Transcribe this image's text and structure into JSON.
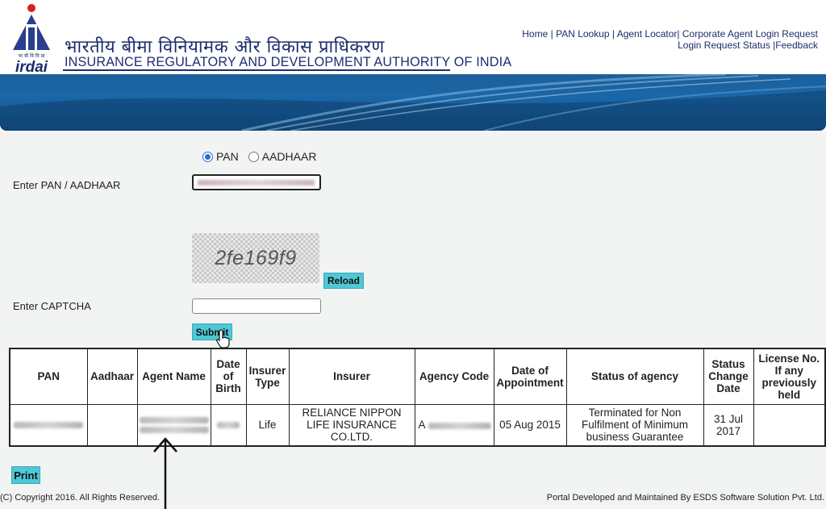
{
  "header": {
    "logo_text": "irdai",
    "logo_hindi": "भा बी वि वि प्रा",
    "title_hindi": "भारतीय बीमा विनियामक और विकास प्राधिकरण",
    "title_en": "INSURANCE REGULATORY AND DEVELOPMENT AUTHORITY OF INDIA",
    "links": {
      "home": "Home",
      "pan_lookup": "PAN Lookup",
      "agent_locator": "Agent Locator",
      "corporate_agent_login_request": "Corporate Agent Login Request",
      "login_request_status": "Login Request Status",
      "feedback": "Feedback"
    }
  },
  "form": {
    "radio_pan": "PAN",
    "radio_aadhaar": "AADHAAR",
    "selected": "PAN",
    "pan_label": "Enter PAN / AADHAAR",
    "captcha_text": "2fe169f9",
    "reload_label": "Reload",
    "captcha_label": "Enter CAPTCHA",
    "submit_label": "Submit"
  },
  "table": {
    "headers": {
      "pan": "PAN",
      "aadhaar": "Aadhaar",
      "agent_name": "Agent Name",
      "date_of_birth": "Date of Birth",
      "insurer_type": "Insurer Type",
      "insurer": "Insurer",
      "agency_code": "Agency Code",
      "date_of_appointment": "Date of Appointment",
      "status_of_agency": "Status of agency",
      "status_change_date": "Status Change Date",
      "license_no": "License No. If any previously held"
    },
    "rows": [
      {
        "insurer_type": "Life",
        "insurer": "RELIANCE NIPPON LIFE INSURANCE CO.LTD.",
        "agency_code_prefix": "A",
        "date_of_appointment": "05 Aug 2015",
        "status_of_agency": "Terminated for Non Fulfilment of Minimum business Guarantee",
        "status_change_date": "31 Jul 2017"
      }
    ]
  },
  "print_label": "Print",
  "footer": {
    "copyright": "(C) Copyright 2016. All Rights Reserved.",
    "developer": "Portal Developed and Maintained By ESDS Software Solution Pvt. Ltd."
  },
  "colors": {
    "button": "#4fc7d6",
    "brand_blue": "#1d2d6e",
    "banner": "#1a67a8"
  }
}
